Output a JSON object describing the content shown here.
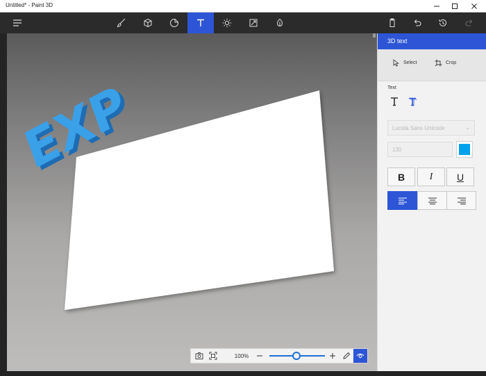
{
  "window": {
    "title": "Untitled* - Paint 3D",
    "controls": [
      "minimize",
      "maximize",
      "close"
    ]
  },
  "toolbar": {
    "menu_icon": "hamburger-icon",
    "tools": [
      {
        "name": "brushes",
        "icon": "brush-icon",
        "active": false
      },
      {
        "name": "3d-shapes",
        "icon": "cube-icon",
        "active": false
      },
      {
        "name": "stickers",
        "icon": "sticker-icon",
        "active": false
      },
      {
        "name": "text",
        "icon": "text-icon",
        "label": "T",
        "active": true
      },
      {
        "name": "effects",
        "icon": "sun-icon",
        "active": false
      },
      {
        "name": "canvas",
        "icon": "canvas-resize-icon",
        "active": false
      },
      {
        "name": "3d-library",
        "icon": "library-icon",
        "active": false
      }
    ],
    "right_actions": [
      "paste-icon",
      "undo-icon",
      "history-icon",
      "redo-icon"
    ]
  },
  "canvas": {
    "text_3d": "EXP",
    "text_color": "#3aa0e8",
    "paper_color": "#ffffff"
  },
  "zoom": {
    "value": "100%",
    "level": 0.5
  },
  "panel": {
    "title": "3D text",
    "select_label": "Select",
    "crop_label": "Crop",
    "text_section": "Text",
    "font": "Lucida Sans Unicode",
    "size": "130",
    "color": "#00a2ed",
    "bold": "B",
    "italic": "I",
    "underline": "U",
    "align_active": "left"
  },
  "colors": {
    "accent": "#2d55d6"
  }
}
